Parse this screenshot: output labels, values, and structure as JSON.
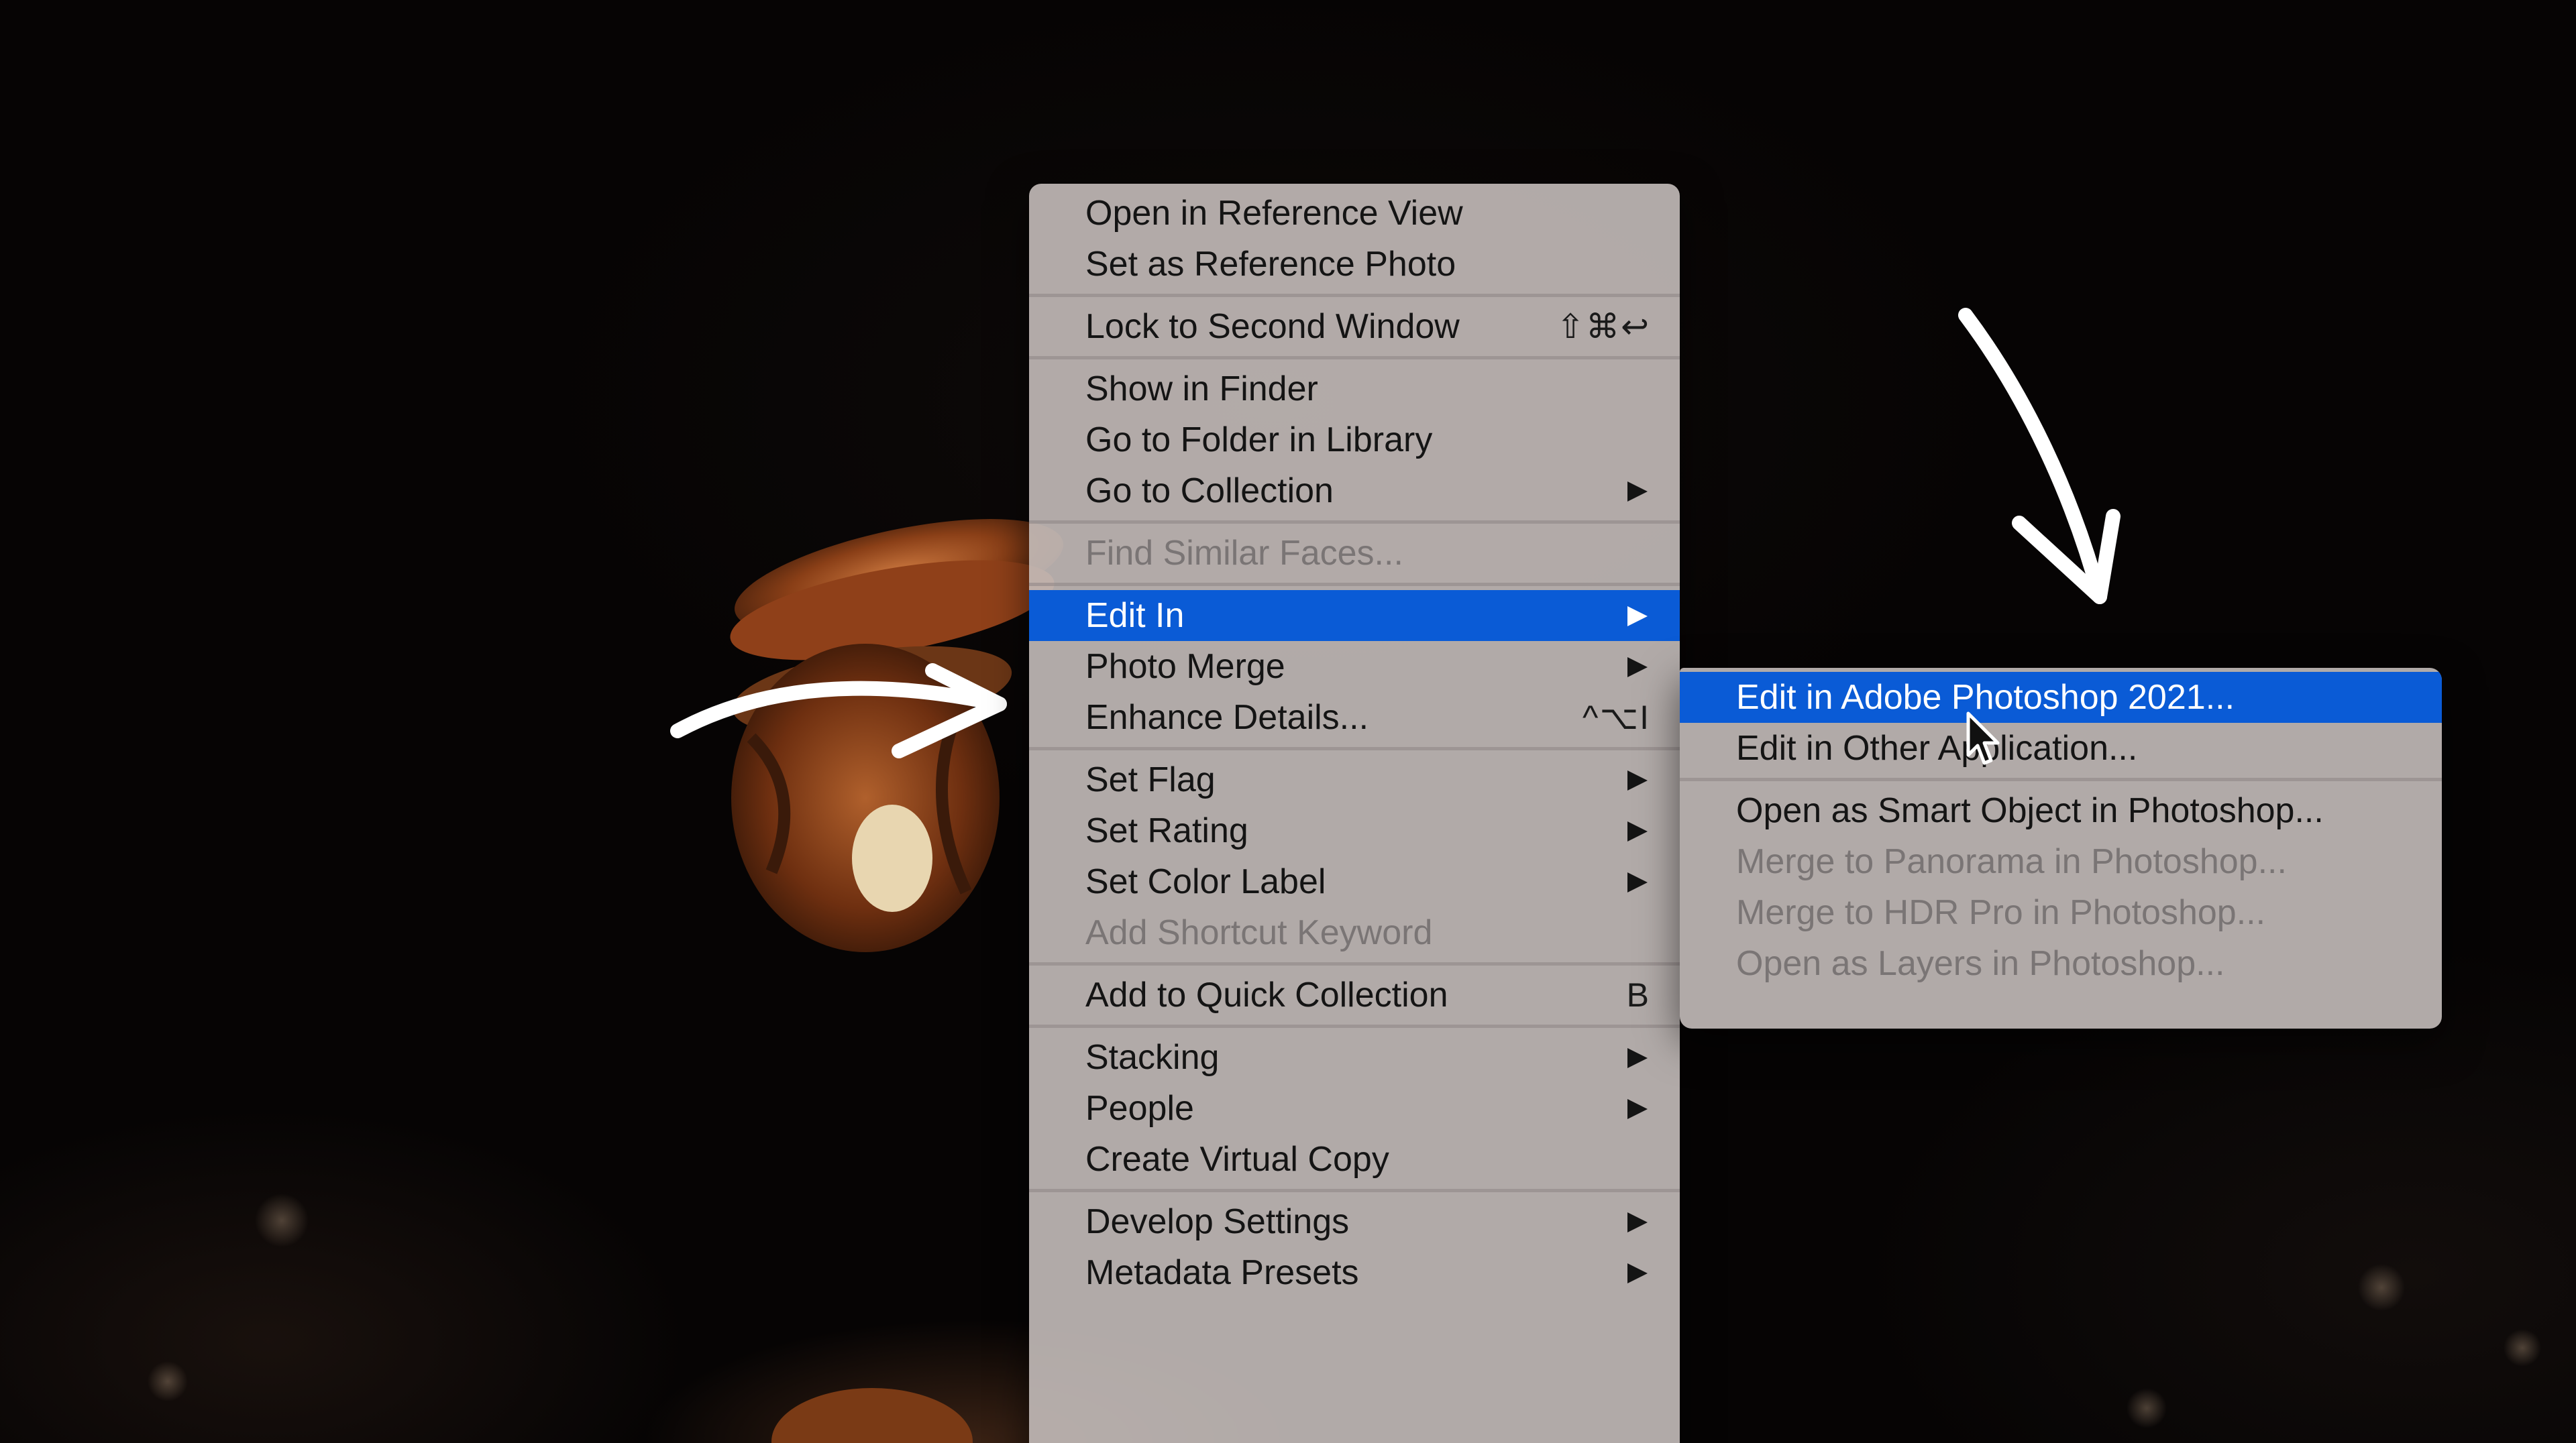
{
  "main_menu": {
    "groups": [
      [
        {
          "label": "Open in Reference View"
        },
        {
          "label": "Set as Reference Photo"
        }
      ],
      [
        {
          "label": "Lock to Second Window",
          "shortcut": "⇧⌘↩"
        }
      ],
      [
        {
          "label": "Show in Finder"
        },
        {
          "label": "Go to Folder in Library"
        },
        {
          "label": "Go to Collection",
          "submenu": true
        }
      ],
      [
        {
          "label": "Find Similar Faces...",
          "disabled": true
        }
      ],
      [
        {
          "label": "Edit In",
          "submenu": true,
          "active": true
        },
        {
          "label": "Photo Merge",
          "submenu": true
        },
        {
          "label": "Enhance Details...",
          "shortcut": "^⌥I"
        }
      ],
      [
        {
          "label": "Set Flag",
          "submenu": true
        },
        {
          "label": "Set Rating",
          "submenu": true
        },
        {
          "label": "Set Color Label",
          "submenu": true
        },
        {
          "label": "Add Shortcut Keyword",
          "disabled": true
        }
      ],
      [
        {
          "label": "Add to Quick Collection",
          "shortcut": "B"
        }
      ],
      [
        {
          "label": "Stacking",
          "submenu": true
        },
        {
          "label": "People",
          "submenu": true
        },
        {
          "label": "Create Virtual Copy"
        }
      ],
      [
        {
          "label": "Develop Settings",
          "submenu": true
        },
        {
          "label": "Metadata Presets",
          "submenu": true
        }
      ]
    ]
  },
  "sub_menu": {
    "groups": [
      [
        {
          "label": "Edit in Adobe Photoshop 2021...",
          "active": true
        },
        {
          "label": "Edit in Other Application..."
        }
      ],
      [
        {
          "label": "Open as Smart Object in Photoshop..."
        },
        {
          "label": "Merge to Panorama in Photoshop...",
          "disabled": true
        },
        {
          "label": "Merge to HDR Pro in Photoshop...",
          "disabled": true
        },
        {
          "label": "Open as Layers in Photoshop...",
          "disabled": true
        }
      ]
    ]
  },
  "colors": {
    "menu_bg": "#c4bcba",
    "highlight": "#0a5bd6",
    "text": "#141414",
    "disabled_text": "#7a7575"
  },
  "icons": [
    "mouse-pointer-icon",
    "submenu-arrow-icon",
    "hand-drawn-arrow-icon"
  ]
}
